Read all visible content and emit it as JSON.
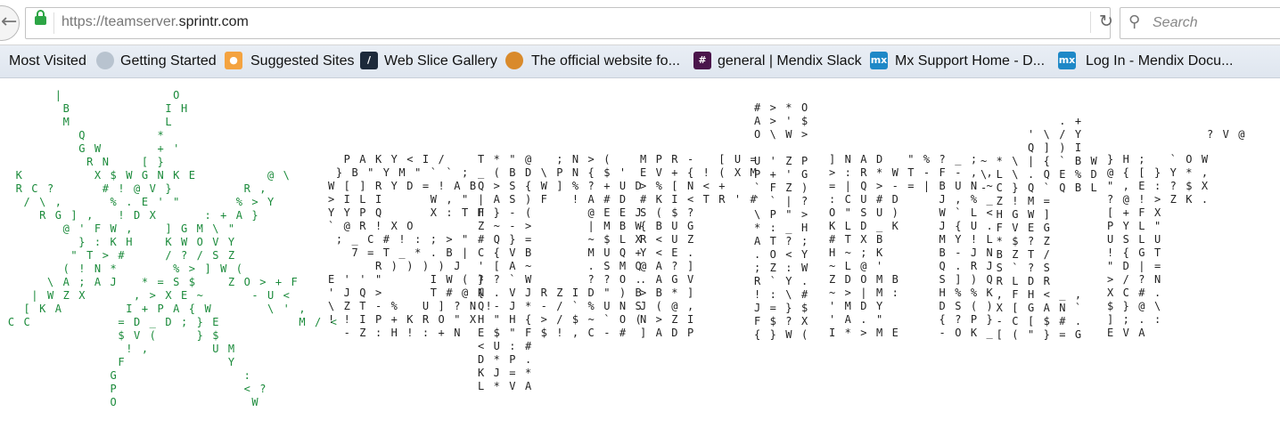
{
  "address_bar": {
    "url_prefix": "https://teamserver.",
    "url_domain": "sprintr.com",
    "search_placeholder": "Search",
    "reload_icon": "reload-icon",
    "back_icon": "back-arrow-icon"
  },
  "bookmarks": [
    {
      "label": "Most Visited",
      "icon": "none"
    },
    {
      "label": "Getting Started",
      "icon": "globe-icon"
    },
    {
      "label": "Suggested Sites",
      "icon": "suggested-sites-icon"
    },
    {
      "label": "Web Slice Gallery",
      "icon": "web-slice-icon"
    },
    {
      "label": "The official website fo...",
      "icon": "site-icon"
    },
    {
      "label": "general | Mendix Slack",
      "icon": "slack-icon"
    },
    {
      "label": "Mx Support Home - D...",
      "icon": "mx-icon"
    },
    {
      "label": "Log In - Mendix Docu...",
      "icon": "mx-icon"
    }
  ],
  "colors": {
    "star_green": "#1a8a3a",
    "star_cyan": "#36b4d6",
    "mx_blue": "#1e88c7",
    "slack_purple": "#4a154b"
  },
  "ascii": {
    "star": "       |              O\n        B            I H\n        M            L\n          Q         *\n          G W       + '\n           R N    [ }\n  K         X $ W G N K E         @ \\\n  R C ?      # ! @ V }         R ,\n   / \\ ,      % . E ' \"       % > Y\n     R G ] ,   ! D X      : + A }\n        @ ' F W ,    ] G M \\ \"\n          } : K H    K W O V Y\n         \" T > #     / ? / S Z\n        ( ! N *       % > ] W (\n      \\ A ; A J   * = S $    Z O > + F\n    | W Z X      , > X E ~      - U <\n   [ K A        I + P A { W       \\ ' ,\n C C           = D _ D ; } E          M / <\n               $ V (     } $\n                ! ,        U M\n               F             Y\n              G                :\n              P                < ?\n              O                 W",
    "cols": [
      "  P A K Y < I /\n } B \" Y M \" ` ` ;\nW [ ] R Y D = ! A B\n> I L I      W , \"\nY Y P Q      X : T H\n` @ R ! X O\n ; _ C # ! : ; > \"\n   7 = T _ * . B |\n      R ) ) ) ) J\nE ' ' \"      I W ( ?\n' J Q >      T # @ {\n\\ Z T - %   U ] ? N !\n! ! I P + K R O \" X\n  - Z : H ! : + N",
      "T * \" @   ; N > (\n_ ( B D \\ P N { $ '\nQ > S { W ] % ? + U D\n| A S ) F   ! A # D\nF } - (       @ E E J\nZ ~ - >       | M B W\n# Q } =       ~ $ L X\nC { V B       M U Q +\n' [ A ~       . S M Q\n} ? ` W       ? ? O .\nN . V J R Z I D \" ) B\nQ - J * - / ` % U N S\nH \" H { > / $ ~ ` O (\nE $ \" F $ ! , C - #\n< U : #\nD * P .\nK J = *\nL * V A",
      "M P R -   [ U =\nE V + { ! ( X M\n> % [ N < +\n# K I < T R ' #\nS ( $ ?\n{ B U G\nR < U Z\nY < E .\n@ A ? ]\n. A G V\n> B * ]\nJ ( @ ,\nN > Z I\n] A D P",
      "# > * O\nA > ' $\nO \\ W >\n\nU ' Z P\nP + ' G\n` F Z )\n` ` | ?\n\\ P \" >\n* : _ H\nA T ? ;\n. O < Y\n; Z : W\nR ` Y .\n! : \\ #\nJ = } $\nF $ ? X\n{ } W (",
      "] N A D   \" % ? _ ;\n> : R * W T - F - , ,\n= | Q > - = | B U N ~\n: C U # D     J , % _\nO \" S U )     W ` L <\nK L D _ K     J { U .\n# T X B       M Y ! L\nH ~ ; K       B - J N\n~ L @ '       Q . R J\nZ D O M B     S ] ) Q\n~ > | M :     H % % K\n' M D Y       D S ( )\n' A . \"       { ? P }\nI * > M E     - O K _",
      "          . +\n      ' \\ / Y\n      Q ] ) I\n~ * \\ | { ` B W\n\\ L \\ . Q E % D\n- C } Q ` Q B L\n  Z ! M =\n  H G W ]\n  F V E G\n  * $ ? Z\n  B Z T /\n  S ` ? S\n  R L D R\n  , F H < _ ,\n  X [ G A N `\n  - C [ $ # .\n  [ ( \" } = G",
      "} H ;   ` O W\n@ { [ } Y * ,\n\" , E : ? $ X\n? @ ! > Z K .\n[ + F X\nP Y L \"\nU S L U\n! { G T\n\" D | =\n> / ? N\nX C # .\n$ } @ \\\n] ; . :\nE V A",
      "? V @"
    ]
  }
}
